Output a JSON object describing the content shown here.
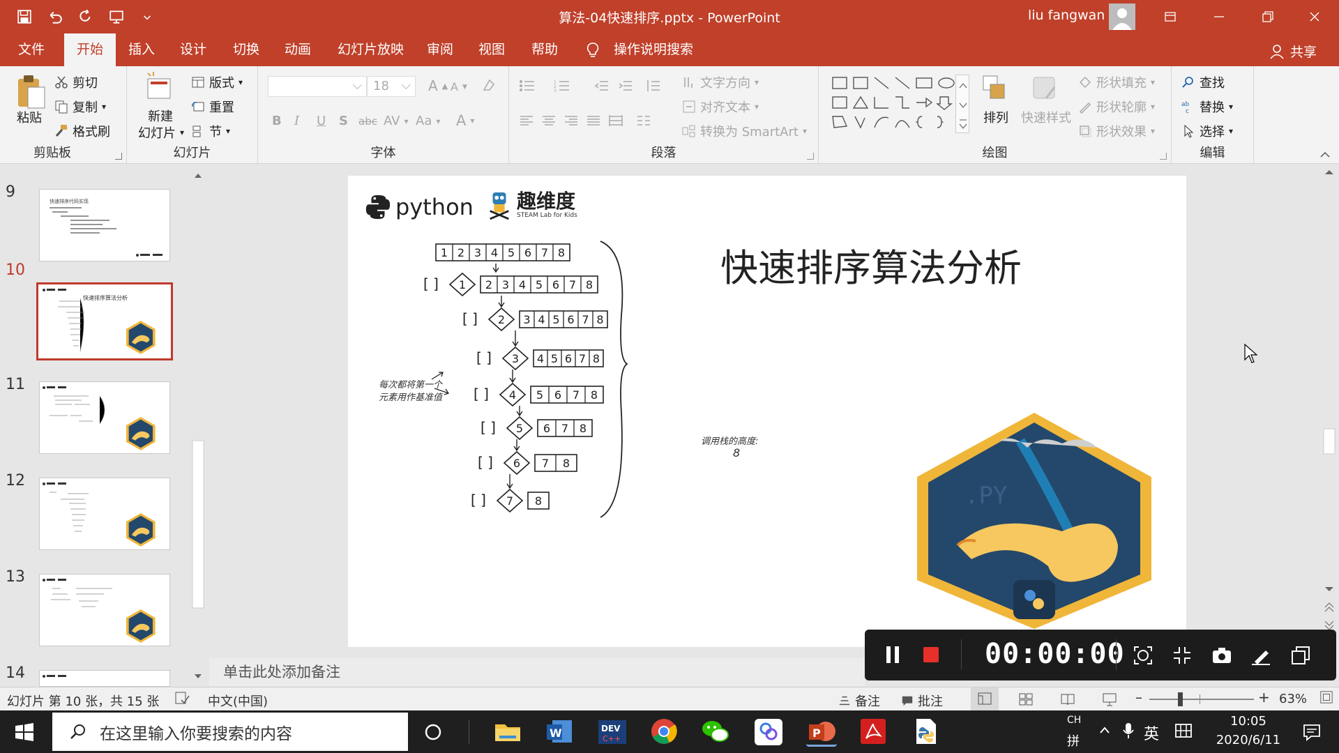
{
  "window": {
    "title": "算法-04快速排序.pptx  -  PowerPoint",
    "user": "liu fangwan"
  },
  "menu": {
    "tabs": [
      "文件",
      "开始",
      "插入",
      "设计",
      "切换",
      "动画",
      "幻灯片放映",
      "审阅",
      "视图",
      "帮助",
      "操作说明搜索"
    ],
    "share": "共享"
  },
  "ribbon": {
    "clipboard": {
      "paste": "粘贴",
      "cut": "剪切",
      "copy": "复制",
      "format_painter": "格式刷",
      "label": "剪贴板"
    },
    "slides": {
      "new_slide_1": "新建",
      "new_slide_2": "幻灯片",
      "layout": "版式",
      "reset": "重置",
      "section": "节",
      "label": "幻灯片"
    },
    "font": {
      "size": "18",
      "bold": "B",
      "italic": "I",
      "underline": "U",
      "shadow": "S",
      "strike": "abc",
      "spacing": "AV",
      "case": "Aa",
      "color": "A",
      "grow": "A",
      "shrink": "A",
      "label": "字体"
    },
    "paragraph": {
      "text_direction": "文字方向",
      "align_text": "对齐文本",
      "smartart": "转换为 SmartArt",
      "label": "段落"
    },
    "drawing": {
      "arrange": "排列",
      "quick_styles": "快速样式",
      "shape_fill": "形状填充",
      "shape_outline": "形状轮廓",
      "shape_effects": "形状效果",
      "label": "绘图"
    },
    "editing": {
      "find": "查找",
      "replace": "替换",
      "select": "选择",
      "label": "编辑"
    }
  },
  "sidebar": {
    "slides": [
      {
        "num": "9",
        "title": "快速排序代码实现"
      },
      {
        "num": "10",
        "title": "快速排序算法分析"
      },
      {
        "num": "11",
        "title": ""
      },
      {
        "num": "12",
        "title": ""
      },
      {
        "num": "13",
        "title": ""
      },
      {
        "num": "14",
        "title": ""
      }
    ]
  },
  "slide": {
    "python_logo_text": "python",
    "brand_name": "趣维度",
    "brand_sub": "STEAM Lab for Kids",
    "title": "快速排序算法分析",
    "rows": [
      {
        "pivot": "",
        "pivot_done": "",
        "items": [
          "1",
          "2",
          "3",
          "4",
          "5",
          "6",
          "7",
          "8"
        ]
      },
      {
        "pivot": "1",
        "items": [
          "2",
          "3",
          "4",
          "5",
          "6",
          "7",
          "8"
        ]
      },
      {
        "pivot": "2",
        "items": [
          "3",
          "4",
          "5",
          "6",
          "7",
          "8"
        ]
      },
      {
        "pivot": "3",
        "items": [
          "4",
          "5",
          "6",
          "7",
          "8"
        ]
      },
      {
        "pivot": "4",
        "items": [
          "5",
          "6",
          "7",
          "8"
        ]
      },
      {
        "pivot": "5",
        "items": [
          "6",
          "7",
          "8"
        ]
      },
      {
        "pivot": "6",
        "items": [
          "7",
          "8"
        ]
      },
      {
        "pivot": "7",
        "items": [
          "8"
        ]
      }
    ],
    "note_left_1": "每次都将第一个",
    "note_left_2": "元素用作基准值",
    "note_right": "调用栈的高度:",
    "note_right_value": "8",
    "badge_text": ".PY"
  },
  "notes": {
    "placeholder": "单击此处添加备注"
  },
  "status": {
    "slide_info": "幻灯片 第 10 张，共 15 张",
    "language": "中文(中国)",
    "notes": "备注",
    "comments": "批注",
    "zoom": "63%"
  },
  "recorder": {
    "time": "00:00:00"
  },
  "taskbar": {
    "search_placeholder": "在这里输入你要搜索的内容",
    "ime_ch": "CH",
    "ime_pin": "拼",
    "ime_lang": "英",
    "time": "10:05",
    "date": "2020/6/11"
  },
  "colors": {
    "accent": "#c0402a",
    "selected_slide": "#c0392b"
  }
}
